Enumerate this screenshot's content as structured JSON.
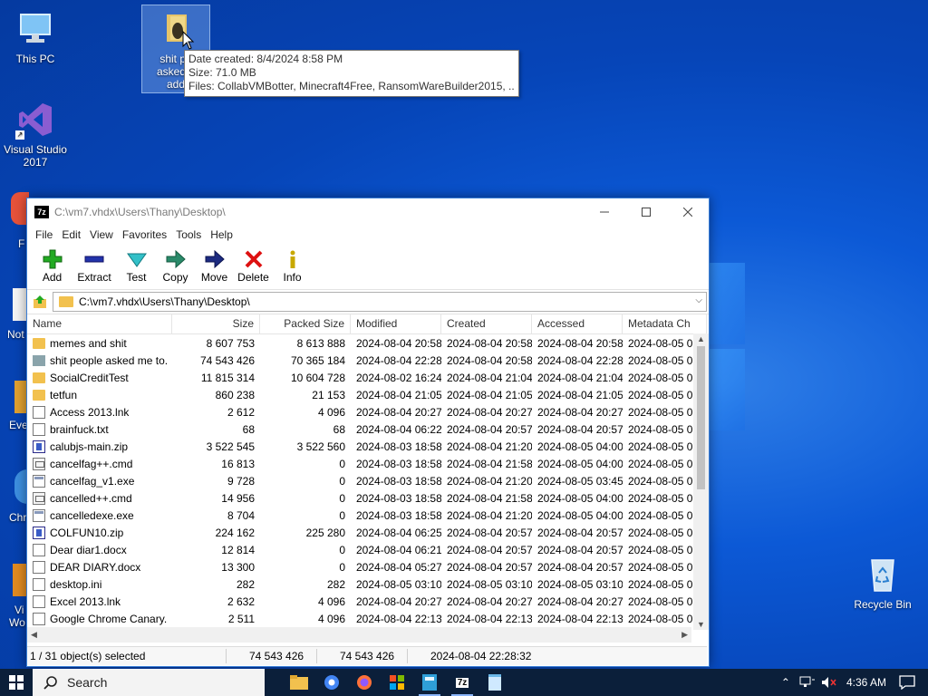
{
  "desktop": {
    "icons": [
      {
        "label": "This PC"
      },
      {
        "label": "Visual Studio 2017"
      },
      {
        "label": "Recycle Bin"
      }
    ],
    "selected_icon_label_lines": [
      "shit pe",
      "asked n",
      "add"
    ],
    "partial_labels": [
      "F",
      "Not",
      "Eve",
      "Chr",
      "Vi",
      "Wo"
    ]
  },
  "tooltip": {
    "line1": "Date created: 8/4/2024 8:58 PM",
    "line2": "Size: 71.0 MB",
    "line3": "Files: CollabVMBotter, Minecraft4Free, RansomWareBuilder2015, ..."
  },
  "window": {
    "app_icon": "7z",
    "title": "C:\\vm7.vhdx\\Users\\Thany\\Desktop\\",
    "menu": [
      "File",
      "Edit",
      "View",
      "Favorites",
      "Tools",
      "Help"
    ],
    "toolbar": [
      "Add",
      "Extract",
      "Test",
      "Copy",
      "Move",
      "Delete",
      "Info"
    ],
    "address": "C:\\vm7.vhdx\\Users\\Thany\\Desktop\\",
    "columns": [
      "Name",
      "Size",
      "Packed Size",
      "Modified",
      "Created",
      "Accessed",
      "Metadata Ch"
    ],
    "rows": [
      {
        "icon": "folder",
        "name": "memes and shit",
        "size": "8 607 753",
        "packed": "8 613 888",
        "modified": "2024-08-04 20:58",
        "created": "2024-08-04 20:58",
        "accessed": "2024-08-04 20:58",
        "meta": "2024-08-05 0"
      },
      {
        "icon": "folder2",
        "name": "shit people asked me to...",
        "size": "74 543 426",
        "packed": "70 365 184",
        "modified": "2024-08-04 22:28",
        "created": "2024-08-04 20:58",
        "accessed": "2024-08-04 22:28",
        "meta": "2024-08-05 0"
      },
      {
        "icon": "folder",
        "name": "SocialCreditTest",
        "size": "11 815 314",
        "packed": "10 604 728",
        "modified": "2024-08-02 16:24",
        "created": "2024-08-04 21:04",
        "accessed": "2024-08-04 21:04",
        "meta": "2024-08-05 0"
      },
      {
        "icon": "folder",
        "name": "tetfun",
        "size": "860 238",
        "packed": "21 153",
        "modified": "2024-08-04 21:05",
        "created": "2024-08-04 21:05",
        "accessed": "2024-08-04 21:05",
        "meta": "2024-08-05 0"
      },
      {
        "icon": "file",
        "name": "Access 2013.lnk",
        "size": "2 612",
        "packed": "4 096",
        "modified": "2024-08-04 20:27",
        "created": "2024-08-04 20:27",
        "accessed": "2024-08-04 20:27",
        "meta": "2024-08-05 0"
      },
      {
        "icon": "file",
        "name": "brainfuck.txt",
        "size": "68",
        "packed": "68",
        "modified": "2024-08-04 06:22",
        "created": "2024-08-04 20:57",
        "accessed": "2024-08-04 20:57",
        "meta": "2024-08-05 0"
      },
      {
        "icon": "zip",
        "name": "calubjs-main.zip",
        "size": "3 522 545",
        "packed": "3 522 560",
        "modified": "2024-08-03 18:58",
        "created": "2024-08-04 21:20",
        "accessed": "2024-08-05 04:00",
        "meta": "2024-08-05 0"
      },
      {
        "icon": "cmd",
        "name": "cancelfag++.cmd",
        "size": "16 813",
        "packed": "0",
        "modified": "2024-08-03 18:58",
        "created": "2024-08-04 21:58",
        "accessed": "2024-08-05 04:00",
        "meta": "2024-08-05 0"
      },
      {
        "icon": "exe",
        "name": "cancelfag_v1.exe",
        "size": "9 728",
        "packed": "0",
        "modified": "2024-08-03 18:58",
        "created": "2024-08-04 21:20",
        "accessed": "2024-08-05 03:45",
        "meta": "2024-08-05 0"
      },
      {
        "icon": "cmd",
        "name": "cancelled++.cmd",
        "size": "14 956",
        "packed": "0",
        "modified": "2024-08-03 18:58",
        "created": "2024-08-04 21:58",
        "accessed": "2024-08-05 04:00",
        "meta": "2024-08-05 0"
      },
      {
        "icon": "exe",
        "name": "cancelledexe.exe",
        "size": "8 704",
        "packed": "0",
        "modified": "2024-08-03 18:58",
        "created": "2024-08-04 21:20",
        "accessed": "2024-08-05 04:00",
        "meta": "2024-08-05 0"
      },
      {
        "icon": "zip",
        "name": "COLFUN10.zip",
        "size": "224 162",
        "packed": "225 280",
        "modified": "2024-08-04 06:25",
        "created": "2024-08-04 20:57",
        "accessed": "2024-08-04 20:57",
        "meta": "2024-08-05 0"
      },
      {
        "icon": "file",
        "name": "Dear diar1.docx",
        "size": "12 814",
        "packed": "0",
        "modified": "2024-08-04 06:21",
        "created": "2024-08-04 20:57",
        "accessed": "2024-08-04 20:57",
        "meta": "2024-08-05 0"
      },
      {
        "icon": "file",
        "name": "DEAR DIARY.docx",
        "size": "13 300",
        "packed": "0",
        "modified": "2024-08-04 05:27",
        "created": "2024-08-04 20:57",
        "accessed": "2024-08-04 20:57",
        "meta": "2024-08-05 0"
      },
      {
        "icon": "file",
        "name": "desktop.ini",
        "size": "282",
        "packed": "282",
        "modified": "2024-08-05 03:10",
        "created": "2024-08-05 03:10",
        "accessed": "2024-08-05 03:10",
        "meta": "2024-08-05 0"
      },
      {
        "icon": "file",
        "name": "Excel 2013.lnk",
        "size": "2 632",
        "packed": "4 096",
        "modified": "2024-08-04 20:27",
        "created": "2024-08-04 20:27",
        "accessed": "2024-08-04 20:27",
        "meta": "2024-08-05 0"
      },
      {
        "icon": "file",
        "name": "Google Chrome Canary....",
        "size": "2 511",
        "packed": "4 096",
        "modified": "2024-08-04 22:13",
        "created": "2024-08-04 22:13",
        "accessed": "2024-08-04 22:13",
        "meta": "2024-08-05 0"
      }
    ],
    "status": [
      "1 / 31 object(s) selected",
      "74 543 426",
      "74 543 426",
      "2024-08-04 22:28:32"
    ]
  },
  "taskbar": {
    "search_label": "Search",
    "apps": [
      "file-explorer-icon",
      "chrome-icon",
      "firefox-icon",
      "office-icon",
      "calculator-icon",
      "7zip-icon",
      "notepad-icon"
    ],
    "app_7z_label": "7z",
    "clock": "4:36 AM"
  },
  "colors": {
    "desktop": "#0645b8",
    "taskbar": "#0b1f3a",
    "folder": "#f2c14e",
    "accent": "#3b7fd6"
  }
}
